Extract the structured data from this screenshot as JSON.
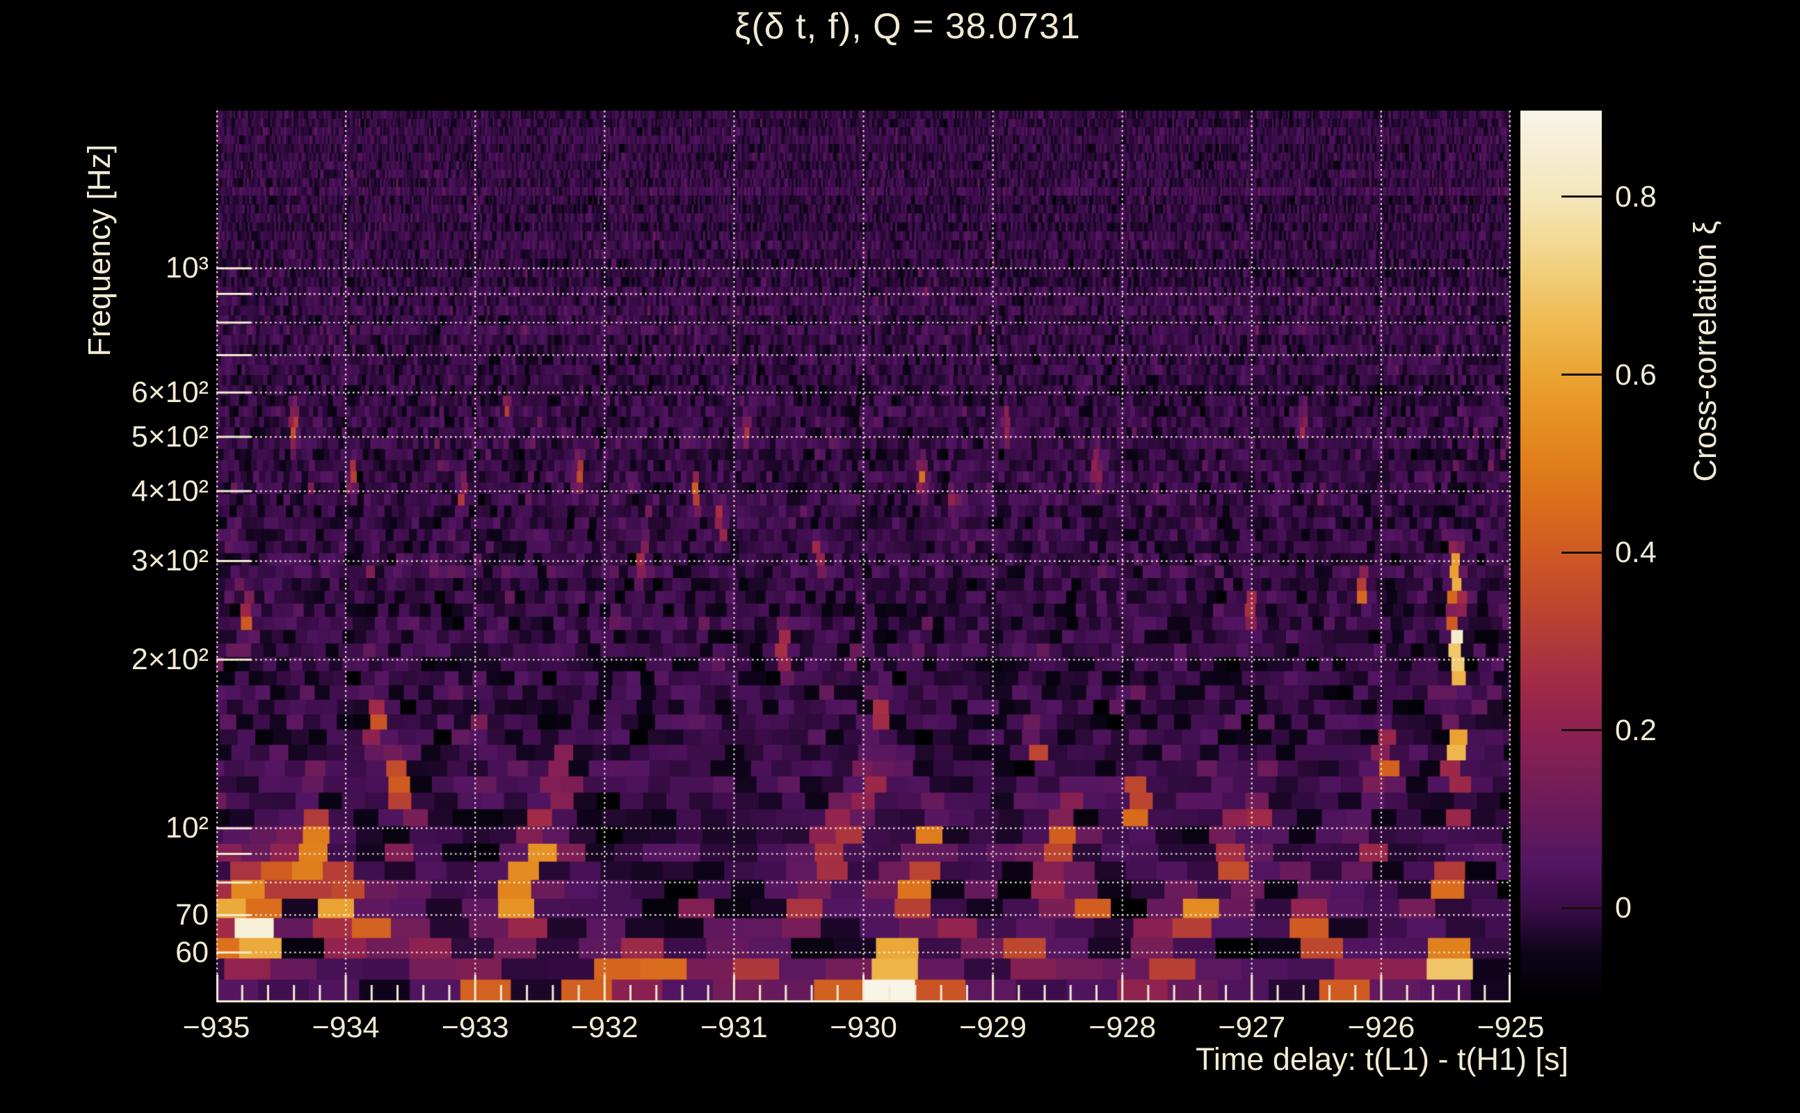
{
  "figure": {
    "background_color": "#000000",
    "text_color": "#f2ebd3",
    "gridline_color": "#f8f2de"
  },
  "chart_data": {
    "type": "heatmap",
    "title": "ξ(δ t, f), Q = 38.0731",
    "q_value": 38.0731,
    "xlabel": "Time delay: t(L1) - t(H1) [s]",
    "ylabel": "Frequency [Hz]",
    "colorbar_label": "Cross-correlation ξ",
    "x_range": [
      -935,
      -925
    ],
    "y_range_hz": [
      48.8,
      1910
    ],
    "y_scale": "log",
    "x_scale": "linear",
    "grid": "dotted",
    "value_range": [
      -0.103,
      0.897
    ],
    "x_ticks": [
      {
        "value": -935,
        "label": "−935"
      },
      {
        "value": -934,
        "label": "−934"
      },
      {
        "value": -933,
        "label": "−933"
      },
      {
        "value": -932,
        "label": "−932"
      },
      {
        "value": -931,
        "label": "−931"
      },
      {
        "value": -930,
        "label": "−930"
      },
      {
        "value": -929,
        "label": "−929"
      },
      {
        "value": -928,
        "label": "−928"
      },
      {
        "value": -927,
        "label": "−927"
      },
      {
        "value": -926,
        "label": "−926"
      },
      {
        "value": -925,
        "label": "−925"
      }
    ],
    "x_minor_tick_step": 0.2,
    "y_ticks": [
      {
        "value": 1000,
        "label": "10³"
      },
      {
        "value": 600,
        "label": "6×10²"
      },
      {
        "value": 500,
        "label": "5×10²"
      },
      {
        "value": 400,
        "label": "4×10²"
      },
      {
        "value": 300,
        "label": "3×10²"
      },
      {
        "value": 200,
        "label": "2×10²"
      },
      {
        "value": 100,
        "label": "10²"
      },
      {
        "value": 70,
        "label": "70"
      },
      {
        "value": 60,
        "label": "60"
      }
    ],
    "y_gridlines_hz": [
      60,
      70,
      80,
      90,
      100,
      200,
      300,
      400,
      500,
      600,
      700,
      800,
      900,
      1000
    ],
    "x_gridlines": [
      -935,
      -934,
      -933,
      -932,
      -931,
      -930,
      -929,
      -928,
      -927,
      -926,
      -925
    ],
    "colorbar_ticks": [
      {
        "value": 0.8,
        "label": "0.8"
      },
      {
        "value": 0.6,
        "label": "0.6"
      },
      {
        "value": 0.4,
        "label": "0.4"
      },
      {
        "value": 0.2,
        "label": "0.2"
      },
      {
        "value": 0,
        "label": "0"
      }
    ],
    "colormap_stops": [
      [
        -0.103,
        "#000003"
      ],
      [
        -0.05,
        "#0e041a"
      ],
      [
        0.0,
        "#3b0d49"
      ],
      [
        0.05,
        "#531562"
      ],
      [
        0.1,
        "#671a5b"
      ],
      [
        0.15,
        "#7a1e56"
      ],
      [
        0.2,
        "#8d2150"
      ],
      [
        0.25,
        "#a02a47"
      ],
      [
        0.3,
        "#b13a3a"
      ],
      [
        0.35,
        "#c14a2c"
      ],
      [
        0.4,
        "#cf5a22"
      ],
      [
        0.45,
        "#d96c1d"
      ],
      [
        0.5,
        "#e07e1c"
      ],
      [
        0.55,
        "#e69124"
      ],
      [
        0.6,
        "#eaa433"
      ],
      [
        0.65,
        "#eeb74d"
      ],
      [
        0.7,
        "#f1c96e"
      ],
      [
        0.75,
        "#f3da95"
      ],
      [
        0.8,
        "#f4e6ba"
      ],
      [
        0.85,
        "#f6eed3"
      ],
      [
        0.897,
        "#f8f4e6"
      ]
    ],
    "noise": {
      "seed": 20150914,
      "mean": -0.006,
      "sigma_base": 0.03,
      "sigma_lowf": 1.6,
      "spike_prob_base": 0.012,
      "spike_prob_lowf": 0.9,
      "spike_amp_base": 0.1,
      "spike_amp_lowf": 9,
      "tile_time_scale": 20,
      "row_height_base": 8,
      "row_height_scale": 170
    },
    "hotspots": [
      [
        -934.92,
        62,
        0.5,
        0.08,
        0.04
      ],
      [
        -934.85,
        76,
        0.75,
        0.07,
        0.05
      ],
      [
        -934.72,
        68,
        0.7,
        0.09,
        0.04
      ],
      [
        -934.6,
        60,
        0.5,
        0.08,
        0.035
      ],
      [
        -934.55,
        80,
        0.45,
        0.06,
        0.04
      ],
      [
        -934.75,
        230,
        0.45,
        0.03,
        0.03
      ],
      [
        -934.4,
        520,
        0.4,
        0.02,
        0.025
      ],
      [
        -934.35,
        88,
        0.6,
        0.06,
        0.04
      ],
      [
        -934.2,
        95,
        0.5,
        0.05,
        0.035
      ],
      [
        -934.15,
        79,
        0.6,
        0.07,
        0.04
      ],
      [
        -934.0,
        71,
        0.55,
        0.08,
        0.04
      ],
      [
        -933.95,
        420,
        0.4,
        0.02,
        0.025
      ],
      [
        -933.85,
        65,
        0.5,
        0.08,
        0.035
      ],
      [
        -933.75,
        150,
        0.4,
        0.04,
        0.035
      ],
      [
        -933.6,
        120,
        0.45,
        0.05,
        0.035
      ],
      [
        -933.5,
        95,
        0.5,
        0.05,
        0.035
      ],
      [
        -933.45,
        60,
        0.45,
        0.09,
        0.03
      ],
      [
        -933.1,
        400,
        0.35,
        0.02,
        0.025
      ],
      [
        -932.9,
        55,
        0.5,
        0.1,
        0.03
      ],
      [
        -932.75,
        70,
        0.55,
        0.08,
        0.04
      ],
      [
        -932.75,
        560,
        0.35,
        0.015,
        0.02
      ],
      [
        -932.6,
        80,
        0.65,
        0.07,
        0.04
      ],
      [
        -932.5,
        92,
        0.5,
        0.05,
        0.035
      ],
      [
        -932.4,
        108,
        0.45,
        0.05,
        0.035
      ],
      [
        -932.3,
        128,
        0.4,
        0.04,
        0.03
      ],
      [
        -932.2,
        430,
        0.4,
        0.02,
        0.025
      ],
      [
        -932.05,
        50,
        0.55,
        0.12,
        0.03
      ],
      [
        -931.85,
        60,
        0.5,
        0.09,
        0.035
      ],
      [
        -931.7,
        300,
        0.35,
        0.025,
        0.025
      ],
      [
        -931.6,
        55,
        0.55,
        0.12,
        0.03
      ],
      [
        -931.3,
        390,
        0.45,
        0.02,
        0.025
      ],
      [
        -931.2,
        65,
        0.45,
        0.08,
        0.035
      ],
      [
        -931.1,
        350,
        0.4,
        0.02,
        0.025
      ],
      [
        -930.9,
        520,
        0.35,
        0.015,
        0.02
      ],
      [
        -930.9,
        57,
        0.5,
        0.1,
        0.03
      ],
      [
        -930.6,
        210,
        0.4,
        0.03,
        0.03
      ],
      [
        -930.55,
        70,
        0.45,
        0.07,
        0.035
      ],
      [
        -930.35,
        300,
        0.35,
        0.02,
        0.025
      ],
      [
        -930.3,
        85,
        0.5,
        0.06,
        0.04
      ],
      [
        -930.15,
        100,
        0.45,
        0.05,
        0.035
      ],
      [
        -930.0,
        49,
        0.7,
        0.18,
        0.035
      ],
      [
        -929.95,
        120,
        0.4,
        0.05,
        0.03
      ],
      [
        -929.9,
        160,
        0.45,
        0.035,
        0.03
      ],
      [
        -929.75,
        50,
        0.6,
        0.1,
        0.03
      ],
      [
        -929.75,
        57,
        0.6,
        0.09,
        0.03
      ],
      [
        -929.7,
        72,
        0.6,
        0.07,
        0.04
      ],
      [
        -929.55,
        420,
        0.45,
        0.02,
        0.025
      ],
      [
        -929.5,
        92,
        0.55,
        0.05,
        0.04
      ],
      [
        -929.35,
        48,
        0.65,
        0.1,
        0.03
      ],
      [
        -929.3,
        380,
        0.35,
        0.02,
        0.02
      ],
      [
        -929.2,
        62,
        0.5,
        0.07,
        0.035
      ],
      [
        -928.9,
        530,
        0.4,
        0.015,
        0.02
      ],
      [
        -928.75,
        60,
        0.45,
        0.08,
        0.03
      ],
      [
        -928.65,
        140,
        0.4,
        0.04,
        0.03
      ],
      [
        -928.5,
        82,
        0.5,
        0.06,
        0.04
      ],
      [
        -928.4,
        95,
        0.6,
        0.05,
        0.04
      ],
      [
        -928.2,
        70,
        0.5,
        0.07,
        0.035
      ],
      [
        -928.2,
        430,
        0.4,
        0.02,
        0.025
      ],
      [
        -928.0,
        50,
        0.5,
        0.12,
        0.03
      ],
      [
        -927.9,
        110,
        0.5,
        0.05,
        0.035
      ],
      [
        -927.65,
        62,
        0.55,
        0.1,
        0.035
      ],
      [
        -927.4,
        70,
        0.5,
        0.08,
        0.035
      ],
      [
        -927.1,
        90,
        0.55,
        0.06,
        0.04
      ],
      [
        -927.0,
        250,
        0.35,
        0.025,
        0.025
      ],
      [
        -926.9,
        100,
        0.45,
        0.05,
        0.035
      ],
      [
        -926.6,
        520,
        0.35,
        0.015,
        0.02
      ],
      [
        -926.5,
        65,
        0.55,
        0.08,
        0.04
      ],
      [
        -926.3,
        58,
        0.5,
        0.09,
        0.03
      ],
      [
        -926.2,
        51,
        0.45,
        0.1,
        0.03
      ],
      [
        -926.15,
        260,
        0.4,
        0.025,
        0.025
      ],
      [
        -926.1,
        90,
        0.4,
        0.05,
        0.035
      ],
      [
        -925.95,
        130,
        0.45,
        0.04,
        0.035
      ],
      [
        -925.75,
        53,
        0.45,
        0.08,
        0.03
      ],
      [
        -925.5,
        58,
        0.65,
        0.1,
        0.04
      ],
      [
        -925.5,
        80,
        0.4,
        0.04,
        0.03
      ],
      [
        -925.42,
        300,
        0.5,
        0.025,
        0.03
      ],
      [
        -925.42,
        250,
        0.8,
        0.025,
        0.04
      ],
      [
        -925.42,
        200,
        0.7,
        0.025,
        0.04
      ],
      [
        -925.42,
        160,
        0.75,
        0.025,
        0.05
      ],
      [
        -925.43,
        125,
        0.6,
        0.03,
        0.04
      ],
      [
        -925.45,
        100,
        0.6,
        0.03,
        0.04
      ]
    ]
  }
}
